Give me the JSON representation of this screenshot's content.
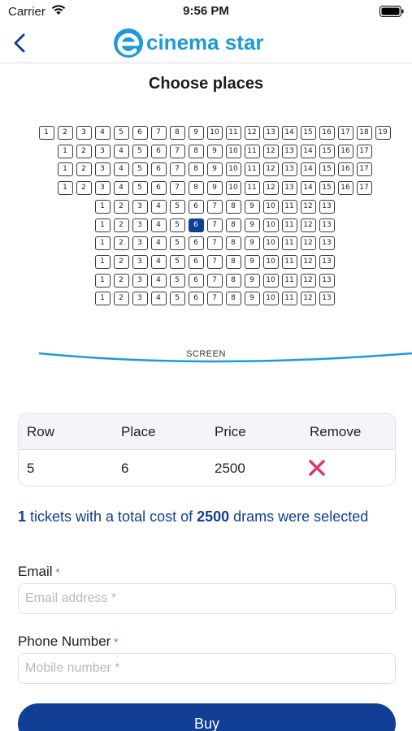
{
  "status_bar": {
    "carrier": "Carrier",
    "time": "9:56 PM"
  },
  "nav": {
    "brand": "cinema star",
    "brand_color": "#1d9bd6"
  },
  "page_title": "Choose places",
  "seat_map": {
    "rows": [
      {
        "row": 1,
        "seats": 19
      },
      {
        "row": 2,
        "seats": 17
      },
      {
        "row": 3,
        "seats": 17
      },
      {
        "row": 4,
        "seats": 17
      },
      {
        "row": 5,
        "seats": 13
      },
      {
        "row": 6,
        "seats": 13
      },
      {
        "row": 7,
        "seats": 13
      },
      {
        "row": 8,
        "seats": 13
      },
      {
        "row": 9,
        "seats": 13
      },
      {
        "row": 10,
        "seats": 13
      }
    ],
    "selected": {
      "row": 6,
      "seat": 6
    },
    "screen_label": "SCREEN"
  },
  "selection_table": {
    "headers": [
      "Row",
      "Place",
      "Price",
      "Remove"
    ],
    "rows": [
      {
        "row": "5",
        "place": "6",
        "price": "2500"
      }
    ]
  },
  "summary": {
    "count": "1",
    "text1": " tickets with a total cost of ",
    "total": "2500",
    "text2": " drams were selected"
  },
  "form": {
    "email_label": "Email",
    "email_placeholder": "Email address *",
    "phone_label": "Phone Number",
    "phone_placeholder": "Mobile number *",
    "required_mark": "*"
  },
  "buy_label": "Buy",
  "colors": {
    "primary": "#103f95",
    "accent": "#1d9bd6",
    "remove": "#d6377a"
  }
}
